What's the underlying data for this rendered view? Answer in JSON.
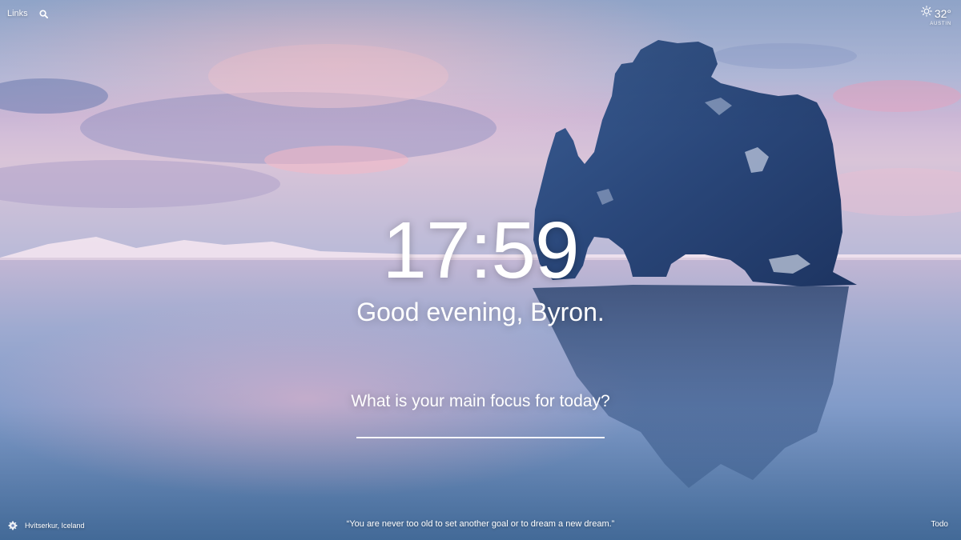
{
  "links": {
    "label": "Links"
  },
  "weather": {
    "temperature": "32°",
    "location": "AUSTIN",
    "icon": "sun-icon"
  },
  "clock": {
    "time": "17:59"
  },
  "greeting": {
    "text": "Good evening, Byron."
  },
  "focus": {
    "question": "What is your main focus for today?",
    "value": ""
  },
  "background": {
    "location": "Hvítserkur, Iceland"
  },
  "quote": {
    "text": "“You are never too old to set another goal or to dream a new dream.”"
  },
  "todo": {
    "label": "Todo"
  },
  "icons": {
    "search": "search-icon",
    "settings": "gear-icon"
  }
}
